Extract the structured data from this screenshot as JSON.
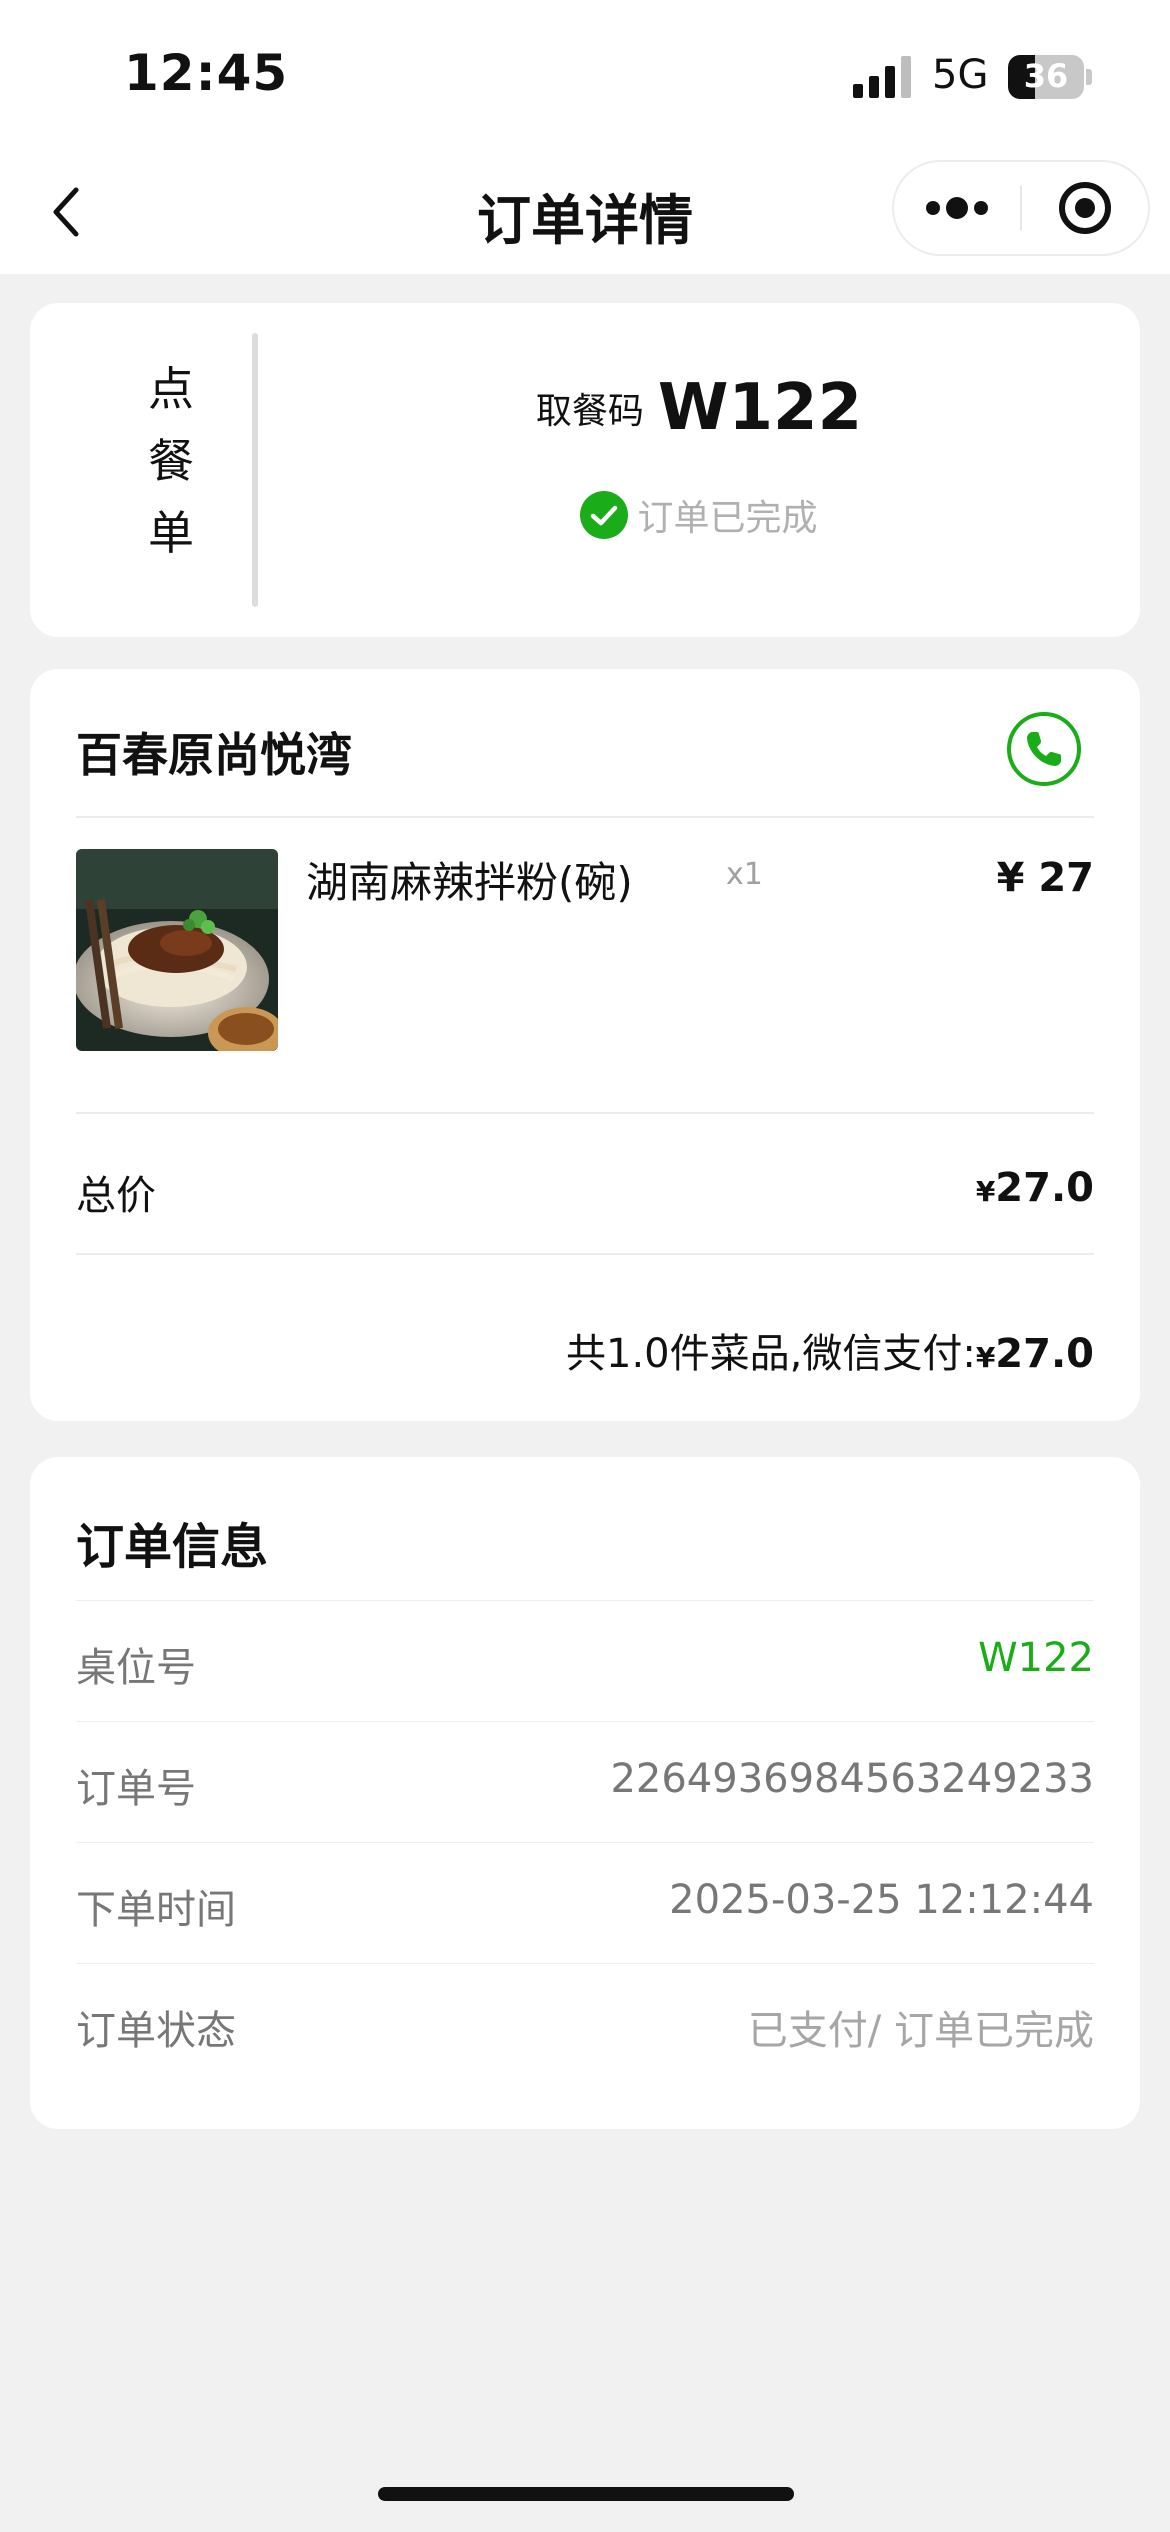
{
  "status_bar": {
    "time": "12:45",
    "network": "5G",
    "battery": "36",
    "battery_level": 0.36
  },
  "nav": {
    "title": "订单详情",
    "back_icon": "chevron-left-icon",
    "more_icon": "more-dots-icon",
    "close_icon": "target-circle-icon"
  },
  "order_header": {
    "tag_chars": [
      "点",
      "餐",
      "单"
    ],
    "pickup_label": "取餐码",
    "pickup_code": "W122",
    "status_text": "订单已完成",
    "status_icon": "check-circle-icon",
    "accent_color": "#1aad19"
  },
  "store": {
    "name": "百春原尚悦湾",
    "phone_icon": "phone-icon",
    "items": [
      {
        "name": "湖南麻辣拌粉(碗)",
        "qty": "x1",
        "price": "¥ 27"
      }
    ],
    "total_label": "总价",
    "total_currency": "¥",
    "total_value": "27.0",
    "summary_text": "共1.0件菜品,微信支付:",
    "summary_currency": "¥",
    "summary_value": "27.0"
  },
  "order_info": {
    "title": "订单信息",
    "rows": [
      {
        "label": "桌位号",
        "value": "W122"
      },
      {
        "label": "订单号",
        "value": "2264936984563249233"
      },
      {
        "label": "下单时间",
        "value": "2025-03-25 12:12:44"
      },
      {
        "label": "订单状态",
        "value": "已支付/ 订单已完成"
      }
    ]
  }
}
